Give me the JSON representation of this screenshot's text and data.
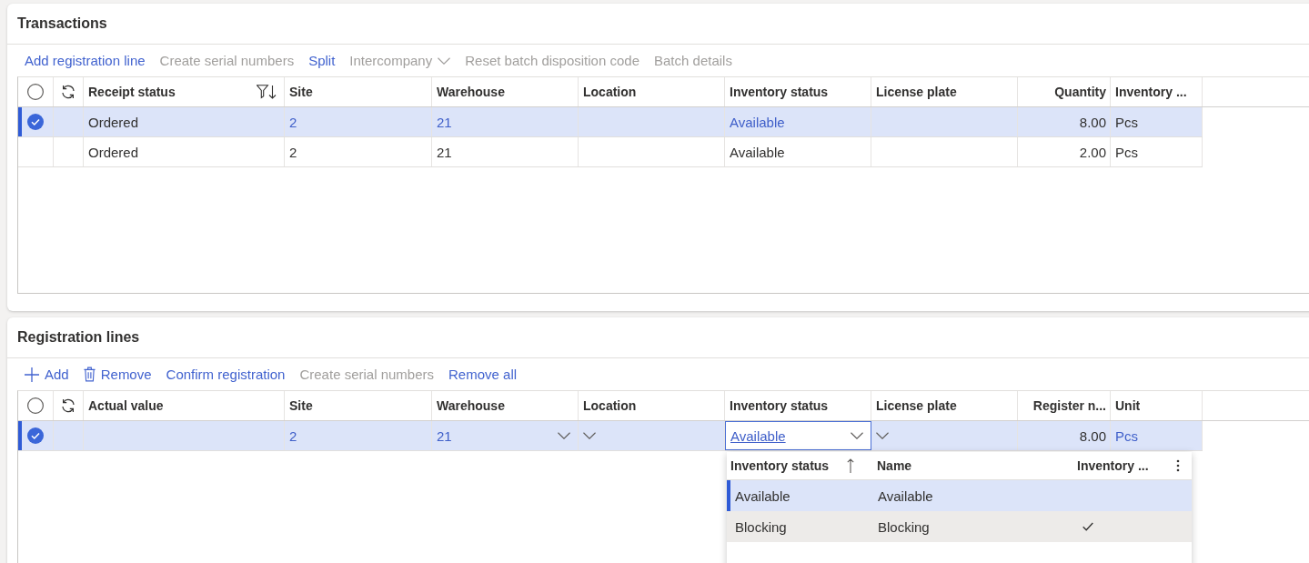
{
  "sections": [
    {
      "title": "Transactions",
      "toolbar": [
        {
          "label": "Add registration line",
          "kind": "plain",
          "disabled": false
        },
        {
          "label": "Create serial numbers",
          "kind": "plain",
          "disabled": true
        },
        {
          "label": "Split",
          "kind": "plain",
          "disabled": false
        },
        {
          "label": "Intercompany",
          "kind": "menu",
          "disabled": true
        },
        {
          "label": "Reset batch disposition code",
          "kind": "plain",
          "disabled": true
        },
        {
          "label": "Batch details",
          "kind": "plain",
          "disabled": true
        }
      ],
      "grid": {
        "all_selected": false,
        "columns": [
          {
            "label": "Receipt status",
            "kind": "text",
            "filtered": true
          },
          {
            "label": "Site",
            "kind": "text",
            "filtered": false
          },
          {
            "label": "Warehouse",
            "kind": "text",
            "filtered": false
          },
          {
            "label": "Location",
            "kind": "text",
            "filtered": false
          },
          {
            "label": "Inventory status",
            "kind": "text",
            "filtered": false
          },
          {
            "label": "License plate",
            "kind": "text",
            "filtered": false
          },
          {
            "label": "Quantity",
            "kind": "number",
            "filtered": false
          },
          {
            "label": "Inventory ...",
            "kind": "text",
            "filtered": false
          }
        ],
        "rows": [
          {
            "selected": true,
            "cells": [
              {
                "text": "Ordered",
                "link": false
              },
              {
                "text": "2",
                "link": true
              },
              {
                "text": "21",
                "link": true
              },
              {},
              {
                "text": "Available",
                "link": true
              },
              {},
              {
                "text": "8.00",
                "link": false
              },
              {
                "text": "Pcs",
                "link": false
              }
            ]
          },
          {
            "selected": false,
            "cells": [
              {
                "text": "Ordered",
                "link": false
              },
              {
                "text": "2",
                "link": false
              },
              {
                "text": "21",
                "link": false
              },
              {},
              {
                "text": "Available",
                "link": false
              },
              {},
              {
                "text": "2.00",
                "link": false
              },
              {
                "text": "Pcs",
                "link": false
              }
            ]
          }
        ]
      }
    },
    {
      "title": "Registration lines",
      "toolbar": [
        {
          "label": "Add",
          "kind": "add",
          "disabled": false
        },
        {
          "label": "Remove",
          "kind": "delete",
          "disabled": false
        },
        {
          "label": "Confirm registration",
          "kind": "plain",
          "disabled": false
        },
        {
          "label": "Create serial numbers",
          "kind": "plain",
          "disabled": true
        },
        {
          "label": "Remove all",
          "kind": "plain",
          "disabled": false
        }
      ],
      "grid": {
        "all_selected": false,
        "columns": [
          {
            "label": "Actual value",
            "kind": "text",
            "filtered": false
          },
          {
            "label": "Site",
            "kind": "text",
            "filtered": false
          },
          {
            "label": "Warehouse",
            "kind": "text",
            "filtered": false
          },
          {
            "label": "Location",
            "kind": "text",
            "filtered": false
          },
          {
            "label": "Inventory status",
            "kind": "text",
            "filtered": false
          },
          {
            "label": "License plate",
            "kind": "text",
            "filtered": false
          },
          {
            "label": "Register n...",
            "kind": "number",
            "filtered": false
          },
          {
            "label": "Unit",
            "kind": "text",
            "filtered": false
          }
        ],
        "rows": [
          {
            "selected": true,
            "cells": [
              {},
              {
                "text": "2",
                "link": true
              },
              {
                "text": "21",
                "link": true,
                "dropdown": true
              },
              {
                "dropdown": true
              },
              {
                "text": "Available",
                "link": true,
                "dropdown": true,
                "editing": true
              },
              {
                "dropdown": true
              },
              {
                "text": "8.00",
                "link": false
              },
              {
                "text": "Pcs",
                "link": true
              }
            ]
          }
        ]
      },
      "lookup": {
        "columns": [
          {
            "label": "Inventory status",
            "sorted": true
          },
          {
            "label": "Name",
            "sorted": false
          },
          {
            "label": "Inventory ...",
            "sorted": false
          }
        ],
        "rows": [
          {
            "status": "Available",
            "name": "Available",
            "checked": false,
            "selected": true,
            "hovered": false
          },
          {
            "status": "Blocking",
            "name": "Blocking",
            "checked": true,
            "selected": false,
            "hovered": true
          }
        ]
      }
    }
  ]
}
